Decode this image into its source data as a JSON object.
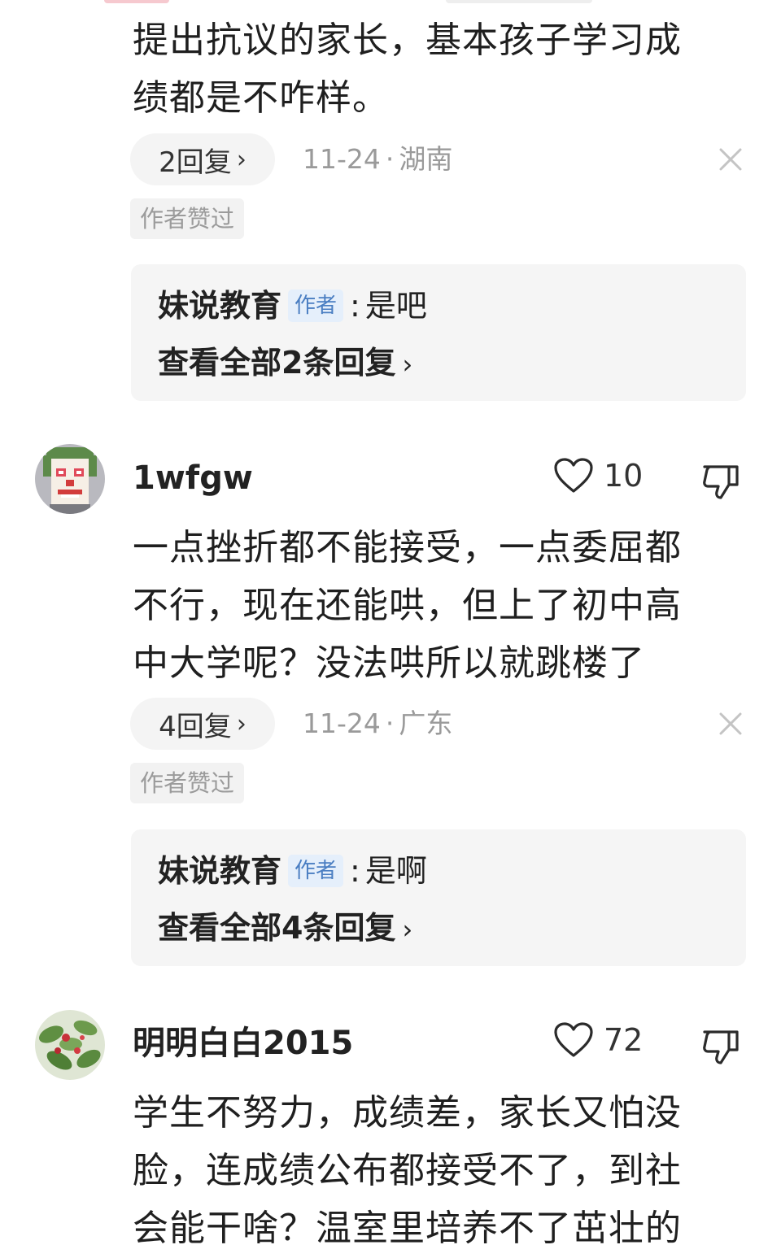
{
  "comments": [
    {
      "body_lines": [
        "提出抗议的家长，基本孩子学习成",
        "绩都是不咋样。"
      ],
      "replies_label": "2回复",
      "date": "11-24",
      "region": "湖南",
      "author_liked": "作者赞过",
      "reply_preview": {
        "name": "妹说教育",
        "tag": "作者",
        "colon": ":",
        "text": "是吧",
        "view_all": "查看全部2条回复"
      }
    },
    {
      "username": "1wfgw",
      "likes": "10",
      "body_lines": [
        "一点挫折都不能接受，一点委屈都",
        "不行，现在还能哄，但上了初中高",
        "中大学呢？没法哄所以就跳楼了"
      ],
      "replies_label": "4回复",
      "date": "11-24",
      "region": "广东",
      "author_liked": "作者赞过",
      "reply_preview": {
        "name": "妹说教育",
        "tag": "作者",
        "colon": ":",
        "text": "是啊",
        "view_all": "查看全部4条回复"
      }
    },
    {
      "username": "明明白白2015",
      "likes": "72",
      "body_lines": [
        "学生不努力，成绩差，家长又怕没",
        "脸，连成绩公布都接受不了，到社",
        "会能干啥？温室里培养不了茁壮的"
      ]
    }
  ],
  "meta_separator": "·",
  "chevron": "›",
  "icons": {
    "like": "heart-outline-icon",
    "dislike": "thumbs-down-icon",
    "close": "close-icon"
  }
}
